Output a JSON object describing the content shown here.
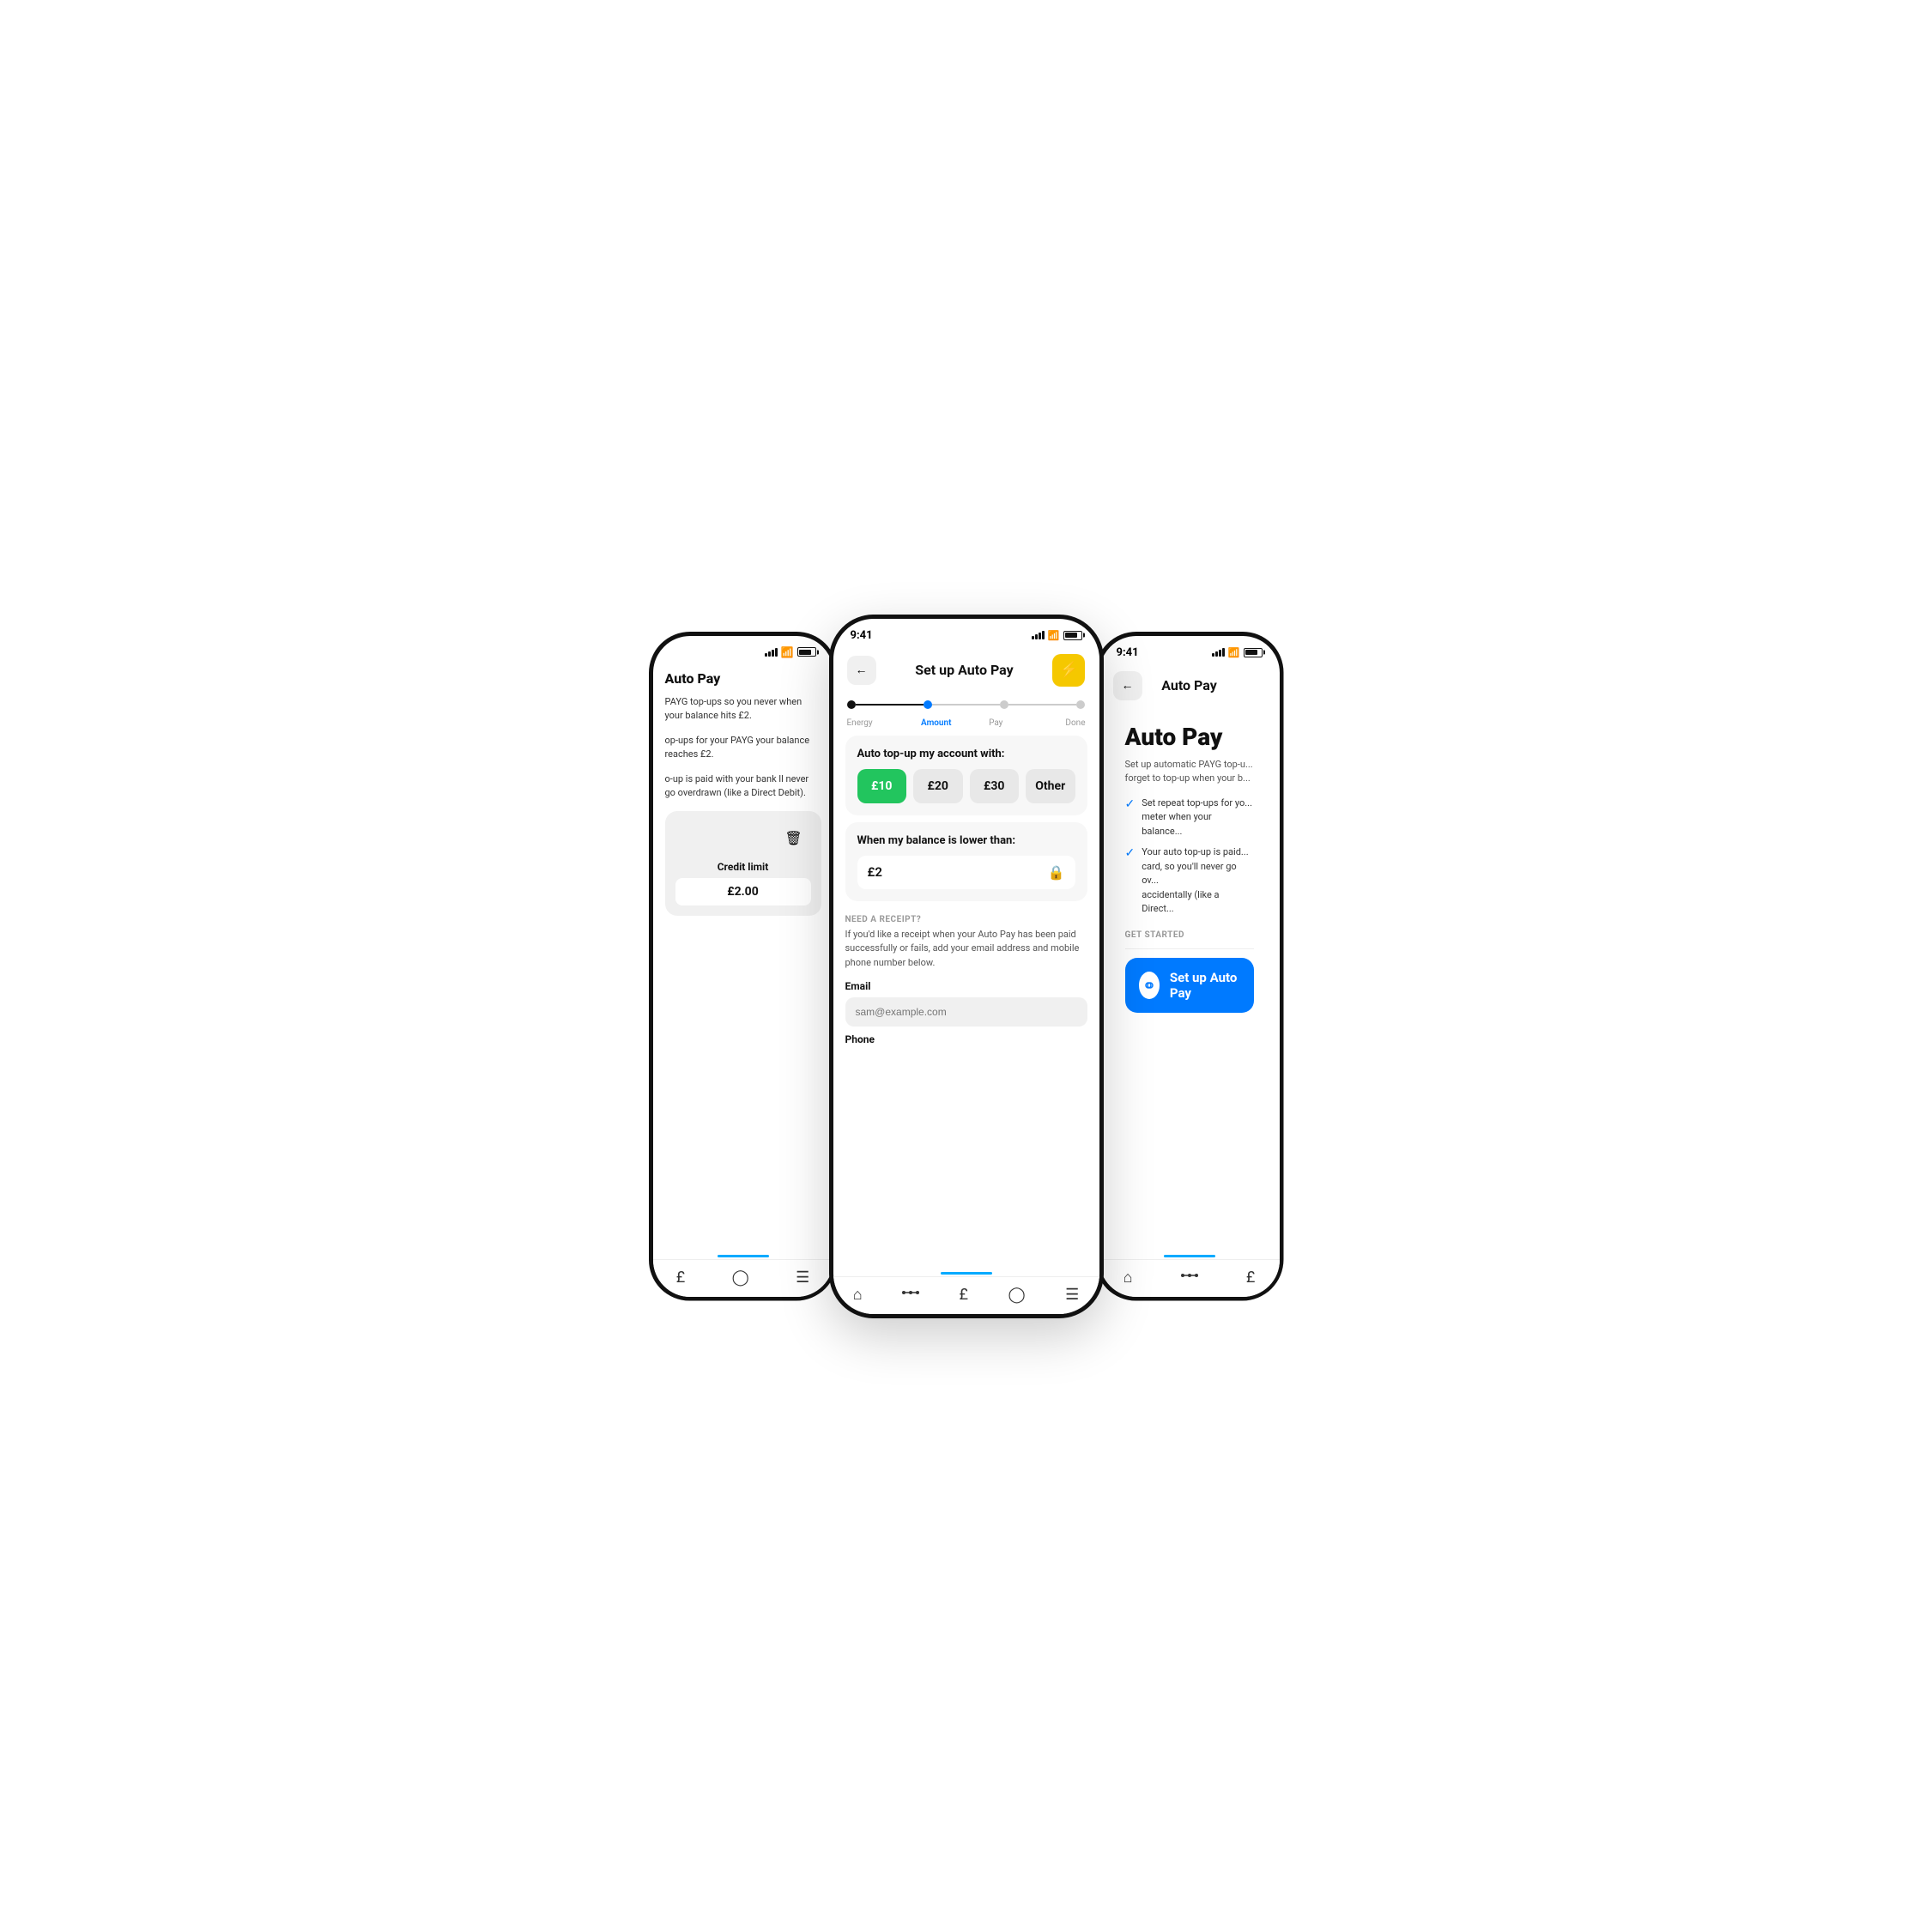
{
  "left_phone": {
    "title": "Auto Pay",
    "description_1": "PAYG top-ups so you never\nwhen your balance hits £2.",
    "description_2": "op-ups for your PAYG\nyour balance reaches £2.",
    "description_3": "o-up is paid with your bank\nll never go overdrawn\n(like a Direct Debit).",
    "credit_limit_label": "Credit limit",
    "credit_limit_value": "£2.00",
    "delete_icon": "🗑",
    "nav": {
      "items": [
        {
          "label": "£",
          "icon": "£"
        },
        {
          "label": "?",
          "icon": "?"
        },
        {
          "label": "≡",
          "icon": "≡"
        }
      ]
    }
  },
  "center_phone": {
    "status_time": "9:41",
    "title": "Set up Auto Pay",
    "back_label": "←",
    "action_icon": "⚡",
    "stepper": {
      "steps": [
        {
          "label": "Energy",
          "state": "done"
        },
        {
          "label": "Amount",
          "state": "active"
        },
        {
          "label": "Pay",
          "state": "upcoming"
        },
        {
          "label": "Done",
          "state": "upcoming"
        }
      ]
    },
    "amount_section": {
      "title": "Auto top-up my account with:",
      "options": [
        {
          "value": "£10",
          "selected": true
        },
        {
          "value": "£20",
          "selected": false
        },
        {
          "value": "£30",
          "selected": false
        },
        {
          "value": "Other",
          "selected": false
        }
      ]
    },
    "balance_section": {
      "title": "When my balance is lower than:",
      "value": "£2",
      "lock_icon": "🔒"
    },
    "receipt_section": {
      "label": "NEED A RECEIPT?",
      "description": "If you'd like a receipt when your Auto Pay has been paid successfully or fails, add your email address and mobile phone number below.",
      "email_label": "Email",
      "email_placeholder": "sam@example.com",
      "phone_label": "Phone"
    },
    "nav": {
      "items": [
        {
          "label": "home",
          "icon": "⌂"
        },
        {
          "label": "activity",
          "icon": "⚬"
        },
        {
          "label": "pay",
          "icon": "£"
        },
        {
          "label": "help",
          "icon": "?"
        },
        {
          "label": "menu",
          "icon": "≡"
        }
      ]
    }
  },
  "right_phone": {
    "status_time": "9:41",
    "title": "Auto Pay",
    "back_label": "←",
    "main_title": "Auto Pay",
    "description": "Set up automatic PAYG top-u...\nforget to top-up when your b...",
    "checks": [
      "Set repeat top-ups for yo...\nmeter when your balance...",
      "Your auto top-up is paid...\ncard, so you'll never go ov...\naccidentally (like a Direct..."
    ],
    "get_started_label": "GET STARTED",
    "setup_button_label": "Set up Auto Pay",
    "setup_button_icon": "∞",
    "nav": {
      "items": [
        {
          "label": "home",
          "icon": "⌂"
        },
        {
          "label": "activity",
          "icon": "⚬"
        },
        {
          "label": "pay",
          "icon": "£"
        }
      ]
    }
  }
}
